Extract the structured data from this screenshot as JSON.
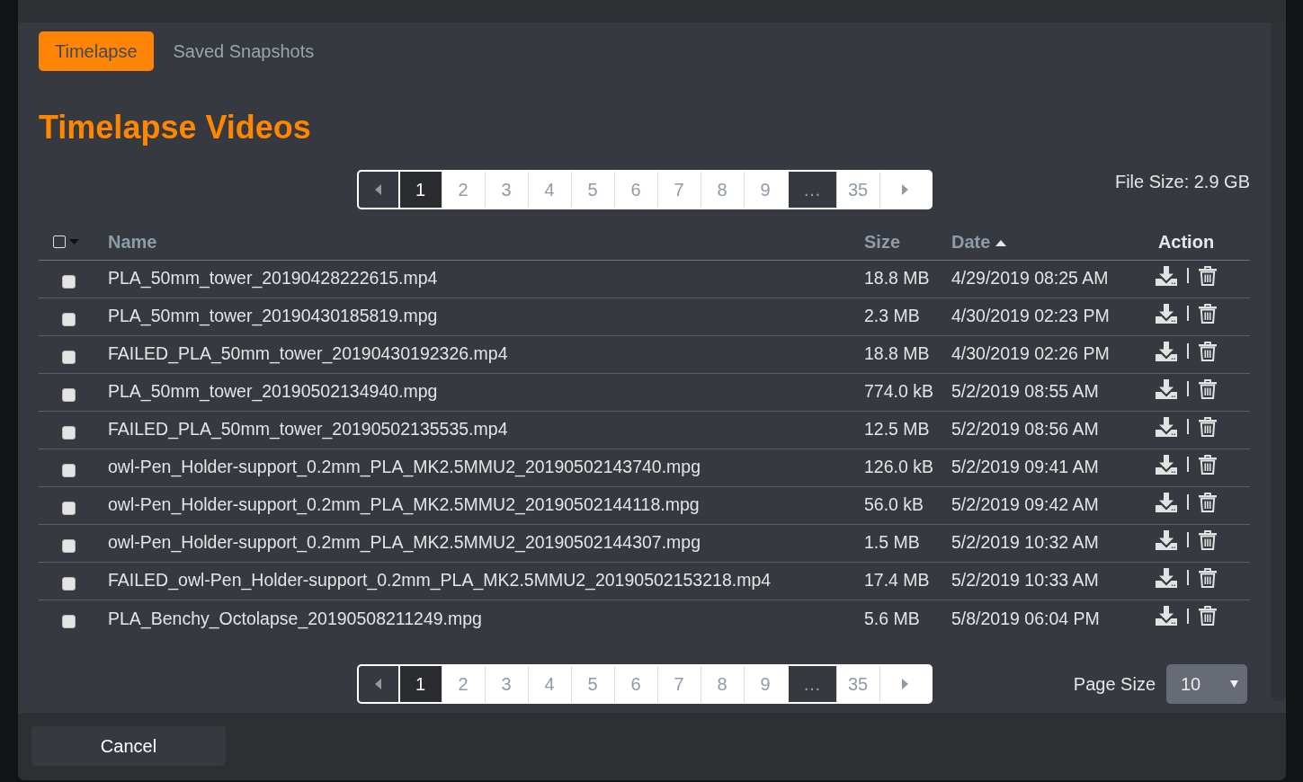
{
  "tabs": [
    {
      "label": "Timelapse",
      "selected": true
    },
    {
      "label": "Saved Snapshots",
      "selected": false
    }
  ],
  "heading": "Timelapse Videos",
  "pagination_top": {
    "items": [
      {
        "kind": "prev",
        "disabled": true
      },
      {
        "kind": "page",
        "label": "1",
        "selected": true
      },
      {
        "kind": "page",
        "label": "2",
        "selected": false
      },
      {
        "kind": "page",
        "label": "3",
        "selected": false
      },
      {
        "kind": "page",
        "label": "4",
        "selected": false
      },
      {
        "kind": "page",
        "label": "5",
        "selected": false
      },
      {
        "kind": "page",
        "label": "6",
        "selected": false
      },
      {
        "kind": "page",
        "label": "7",
        "selected": false
      },
      {
        "kind": "page",
        "label": "8",
        "selected": false
      },
      {
        "kind": "page",
        "label": "9",
        "selected": false
      },
      {
        "kind": "ellipsis",
        "label": "…"
      },
      {
        "kind": "page",
        "label": "35",
        "selected": false
      },
      {
        "kind": "next",
        "disabled": false
      }
    ]
  },
  "file_size": "File Size: 2.9 GB",
  "table": {
    "select_all": {
      "checked": false
    },
    "columns": [
      {
        "label": "Name",
        "sortable": true,
        "sorted": false
      },
      {
        "label": "Size",
        "sortable": true,
        "sorted": false
      },
      {
        "label": "Date",
        "sortable": true,
        "sorted": true
      },
      {
        "label": "Action",
        "sortable": false,
        "sorted": false
      }
    ],
    "rows": [
      {
        "checked": false,
        "name": "PLA_50mm_tower_20190428222615.mp4",
        "size": "18.8 MB",
        "date": "4/29/2019 08:25 AM"
      },
      {
        "checked": false,
        "name": "PLA_50mm_tower_20190430185819.mpg",
        "size": "2.3 MB",
        "date": "4/30/2019 02:23 PM"
      },
      {
        "checked": false,
        "name": "FAILED_PLA_50mm_tower_20190430192326.mp4",
        "size": "18.8 MB",
        "date": "4/30/2019 02:26 PM"
      },
      {
        "checked": false,
        "name": "PLA_50mm_tower_20190502134940.mpg",
        "size": "774.0 kB",
        "date": "5/2/2019 08:55 AM"
      },
      {
        "checked": false,
        "name": "FAILED_PLA_50mm_tower_20190502135535.mp4",
        "size": "12.5 MB",
        "date": "5/2/2019 08:56 AM"
      },
      {
        "checked": false,
        "name": "owl-Pen_Holder-support_0.2mm_PLA_MK2.5MMU2_20190502143740.mpg",
        "size": "126.0 kB",
        "date": "5/2/2019 09:41 AM"
      },
      {
        "checked": false,
        "name": "owl-Pen_Holder-support_0.2mm_PLA_MK2.5MMU2_20190502144118.mpg",
        "size": "56.0 kB",
        "date": "5/2/2019 09:42 AM"
      },
      {
        "checked": false,
        "name": "owl-Pen_Holder-support_0.2mm_PLA_MK2.5MMU2_20190502144307.mpg",
        "size": "1.5 MB",
        "date": "5/2/2019 10:32 AM"
      },
      {
        "checked": false,
        "name": "FAILED_owl-Pen_Holder-support_0.2mm_PLA_MK2.5MMU2_20190502153218.mp4",
        "size": "17.4 MB",
        "date": "5/2/2019 10:33 AM"
      },
      {
        "checked": false,
        "name": "PLA_Benchy_Octolapse_20190508211249.mpg",
        "size": "5.6 MB",
        "date": "5/8/2019 06:04 PM"
      }
    ]
  },
  "pagination_bottom": {
    "items": [
      {
        "kind": "prev",
        "disabled": true
      },
      {
        "kind": "page",
        "label": "1",
        "selected": true
      },
      {
        "kind": "page",
        "label": "2",
        "selected": false
      },
      {
        "kind": "page",
        "label": "3",
        "selected": false
      },
      {
        "kind": "page",
        "label": "4",
        "selected": false
      },
      {
        "kind": "page",
        "label": "5",
        "selected": false
      },
      {
        "kind": "page",
        "label": "6",
        "selected": false
      },
      {
        "kind": "page",
        "label": "7",
        "selected": false
      },
      {
        "kind": "page",
        "label": "8",
        "selected": false
      },
      {
        "kind": "page",
        "label": "9",
        "selected": false
      },
      {
        "kind": "ellipsis",
        "label": "…"
      },
      {
        "kind": "page",
        "label": "35",
        "selected": false
      },
      {
        "kind": "next",
        "disabled": false
      }
    ]
  },
  "page_size": {
    "label": "Page Size",
    "value": "10"
  },
  "footer_buttons": [
    {
      "label": "Cancel"
    }
  ]
}
